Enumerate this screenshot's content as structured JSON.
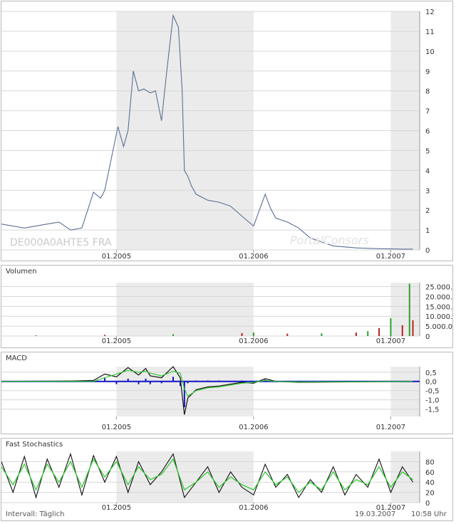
{
  "colors": {
    "price_line": "#5a6f96",
    "shade": "#ebebeb",
    "grid": "#d7d7d7",
    "vol_up": "#2f9e2f",
    "vol_down": "#b82222",
    "macd_hist": "#1414c8",
    "macd_line": "#111111",
    "signal_line": "#33cc33",
    "stoch_k": "#111111",
    "stoch_d": "#33cc33"
  },
  "x_axis_labels": [
    "01.2005",
    "01.2006",
    "01.2007"
  ],
  "price_panel": {
    "instrument_label": "DE000A0AHTE5  FRA",
    "watermark": "PortalConsors",
    "y_ticks": [
      "0",
      "1",
      "2",
      "3",
      "4",
      "5",
      "6",
      "7",
      "8",
      "9",
      "10",
      "11",
      "12"
    ]
  },
  "volume_panel": {
    "title": "Volumen",
    "y_ticks": [
      "0",
      "5.000.000",
      "10.000.000",
      "15.000.000",
      "20.000.000",
      "25.000.000"
    ]
  },
  "macd_panel": {
    "title": "MACD",
    "y_ticks": [
      "0,5",
      "0,0",
      "-0,5",
      "-1,0",
      "-1,5"
    ]
  },
  "stoch_panel": {
    "title": "Fast Stochastics",
    "y_ticks": [
      "80",
      "60",
      "40",
      "20",
      "0"
    ]
  },
  "footer": {
    "interval": "Intervall:  Täglich",
    "date": "19.03.2007",
    "time": "10:58 Uhr"
  },
  "chart_data": [
    {
      "type": "line",
      "panel": "price",
      "x_range": [
        "2004-03",
        "2007-03"
      ],
      "ylim": [
        0,
        12.5
      ],
      "series": [
        {
          "name": "DE000A0AHTE5  FRA",
          "x": [
            "2004-03",
            "2004-05",
            "2004-07",
            "2004-08",
            "2004-09",
            "2004-10",
            "2004-11",
            "2004-11-20",
            "2004-12",
            "2005-01-05",
            "2005-01-20",
            "2005-02",
            "2005-02-15",
            "2005-03",
            "2005-03-15",
            "2005-04",
            "2005-04-15",
            "2005-05",
            "2005-05-15",
            "2005-06",
            "2005-06-15",
            "2005-06-25",
            "2005-07",
            "2005-07-10",
            "2005-07-20",
            "2005-08",
            "2005-09",
            "2005-10",
            "2005-11",
            "2005-12",
            "2006-01",
            "2006-02",
            "2006-02-15",
            "2006-03",
            "2006-04",
            "2006-05",
            "2006-06",
            "2006-07",
            "2006-08",
            "2006-09",
            "2006-10",
            "2006-11",
            "2006-12",
            "2007-01",
            "2007-02",
            "2007-03"
          ],
          "values": [
            1.3,
            1.1,
            1.3,
            1.4,
            1.0,
            1.1,
            2.9,
            2.6,
            3.0,
            6.2,
            5.2,
            6.0,
            9.0,
            8.0,
            8.1,
            7.9,
            8.0,
            6.5,
            9.0,
            11.8,
            11.2,
            8.0,
            4.0,
            3.7,
            3.2,
            2.8,
            2.5,
            2.4,
            2.2,
            1.7,
            1.2,
            2.8,
            2.1,
            1.6,
            1.4,
            1.1,
            0.6,
            0.4,
            0.2,
            0.15,
            0.1,
            0.08,
            0.06,
            0.05,
            0.04,
            0.04
          ]
        }
      ]
    },
    {
      "type": "bar",
      "panel": "volume",
      "title": "Volumen",
      "x_range": [
        "2004-03",
        "2007-03"
      ],
      "ylim": [
        0,
        27000000
      ],
      "series": [
        {
          "x": [
            "2004-06",
            "2004-12",
            "2005-06",
            "2005-12",
            "2006-01",
            "2006-04",
            "2006-07",
            "2006-10",
            "2006-11",
            "2006-12",
            "2007-01",
            "2007-02",
            "2007-02-20",
            "2007-03"
          ],
          "values": [
            400000,
            600000,
            900000,
            1500000,
            1800000,
            1200000,
            1400000,
            1800000,
            2500000,
            4000000,
            9000000,
            5500000,
            26500000,
            8000000
          ]
        }
      ]
    },
    {
      "type": "line",
      "panel": "macd",
      "title": "MACD",
      "x_range": [
        "2004-03",
        "2007-03"
      ],
      "ylim": [
        -1.9,
        0.8
      ],
      "series": [
        {
          "x": [
            "2004-03",
            "2004-09",
            "2004-11",
            "2004-12",
            "2005-01",
            "2005-02",
            "2005-03",
            "2005-03-20",
            "2005-04",
            "2005-05",
            "2005-06",
            "2005-06-20",
            "2005-07",
            "2005-07-10",
            "2005-08",
            "2005-09",
            "2005-10",
            "2005-12",
            "2006-01",
            "2006-02",
            "2006-03",
            "2006-05",
            "2007-03"
          ],
          "values": [
            0.0,
            0.02,
            0.05,
            0.4,
            0.25,
            0.75,
            0.35,
            0.7,
            0.3,
            0.2,
            0.8,
            0.2,
            -1.8,
            -0.9,
            -0.45,
            -0.3,
            -0.25,
            -0.05,
            -0.1,
            0.15,
            0.0,
            -0.05,
            0.0
          ]
        },
        {
          "x": [
            "2004-03",
            "2004-09",
            "2004-11",
            "2004-12",
            "2005-01",
            "2005-02",
            "2005-03",
            "2005-03-20",
            "2005-04",
            "2005-05",
            "2005-06",
            "2005-06-20",
            "2005-07",
            "2005-07-10",
            "2005-08",
            "2005-09",
            "2005-10",
            "2005-12",
            "2006-01",
            "2006-02",
            "2006-03",
            "2006-05",
            "2007-03"
          ],
          "values": [
            0.0,
            0.0,
            0.0,
            0.2,
            0.4,
            0.6,
            0.5,
            0.55,
            0.45,
            0.3,
            0.55,
            0.45,
            -0.4,
            -0.8,
            -0.5,
            -0.35,
            -0.3,
            -0.1,
            -0.05,
            0.05,
            0.0,
            -0.03,
            0.0
          ]
        }
      ]
    },
    {
      "type": "line",
      "panel": "stochastics",
      "title": "Fast Stochastics",
      "x_range": [
        "2004-03",
        "2007-03"
      ],
      "ylim": [
        0,
        100
      ],
      "series": [
        {
          "x": [
            "2004-03",
            "2004-04",
            "2004-05",
            "2004-06",
            "2004-07",
            "2004-08",
            "2004-09",
            "2004-10",
            "2004-11",
            "2004-12",
            "2005-01",
            "2005-02",
            "2005-03",
            "2005-04",
            "2005-05",
            "2005-06",
            "2005-07",
            "2005-08",
            "2005-09",
            "2005-10",
            "2005-11",
            "2005-12",
            "2006-01",
            "2006-02",
            "2006-03",
            "2006-04",
            "2006-05",
            "2006-06",
            "2006-07",
            "2006-08",
            "2006-09",
            "2006-10",
            "2006-11",
            "2006-12",
            "2007-01",
            "2007-02",
            "2007-03"
          ],
          "values": [
            80,
            20,
            90,
            10,
            85,
            30,
            95,
            15,
            92,
            40,
            90,
            20,
            80,
            35,
            60,
            95,
            10,
            40,
            70,
            20,
            60,
            30,
            15,
            75,
            30,
            55,
            10,
            45,
            20,
            70,
            15,
            55,
            30,
            85,
            20,
            70,
            40
          ]
        },
        {
          "x": [
            "2004-03",
            "2004-04",
            "2004-05",
            "2004-06",
            "2004-07",
            "2004-08",
            "2004-09",
            "2004-10",
            "2004-11",
            "2004-12",
            "2005-01",
            "2005-02",
            "2005-03",
            "2005-04",
            "2005-05",
            "2005-06",
            "2005-07",
            "2005-08",
            "2005-09",
            "2005-10",
            "2005-11",
            "2005-12",
            "2006-01",
            "2006-02",
            "2006-03",
            "2006-04",
            "2006-05",
            "2006-06",
            "2006-07",
            "2006-08",
            "2006-09",
            "2006-10",
            "2006-11",
            "2006-12",
            "2007-01",
            "2007-02",
            "2007-03"
          ],
          "values": [
            70,
            35,
            75,
            25,
            75,
            40,
            80,
            30,
            85,
            50,
            80,
            35,
            70,
            45,
            55,
            85,
            25,
            40,
            60,
            30,
            50,
            35,
            25,
            60,
            35,
            50,
            20,
            40,
            25,
            60,
            25,
            45,
            35,
            70,
            30,
            60,
            45
          ]
        }
      ]
    }
  ]
}
